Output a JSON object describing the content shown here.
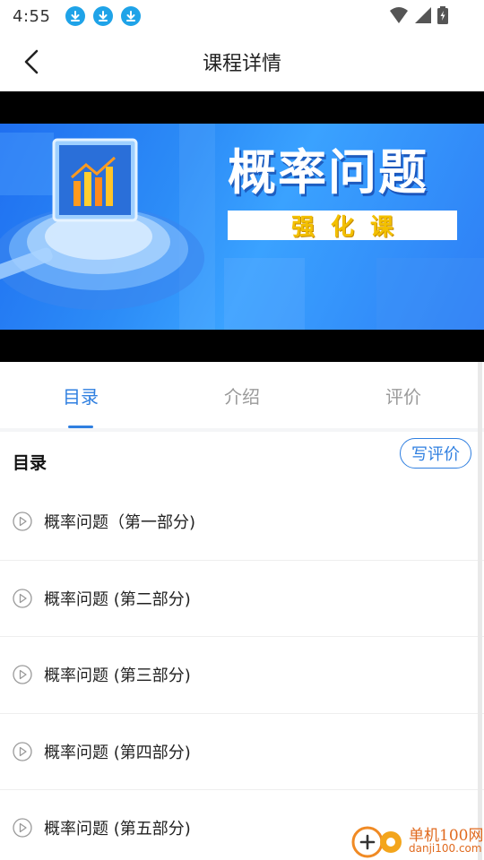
{
  "status_bar": {
    "time": "4:55",
    "icons": [
      "download-icon",
      "download-icon",
      "download-icon",
      "wifi-icon",
      "signal-icon",
      "battery-icon"
    ]
  },
  "header": {
    "title": "课程详情",
    "back_icon": "chevron-left-icon"
  },
  "banner": {
    "title": "概率问题",
    "subtitle": "强化课"
  },
  "tabs": [
    {
      "label": "目录",
      "active": true
    },
    {
      "label": "介绍",
      "active": false
    },
    {
      "label": "评价",
      "active": false
    }
  ],
  "catalog": {
    "title": "目录",
    "review_button": "写评价",
    "lessons": [
      {
        "label": "概率问题（第一部分)"
      },
      {
        "label": "概率问题 (第二部分)"
      },
      {
        "label": "概率问题 (第三部分)"
      },
      {
        "label": "概率问题 (第四部分)"
      },
      {
        "label": "概率问题 (第五部分)"
      }
    ]
  },
  "watermark": {
    "line1": "单机100网",
    "line2": "danji100.com"
  },
  "colors": {
    "accent": "#2f7fe0",
    "download_badge": "#1fa3e8",
    "banner_blue": "#2c8cf7",
    "banner_subtitle": "#f3c000"
  }
}
